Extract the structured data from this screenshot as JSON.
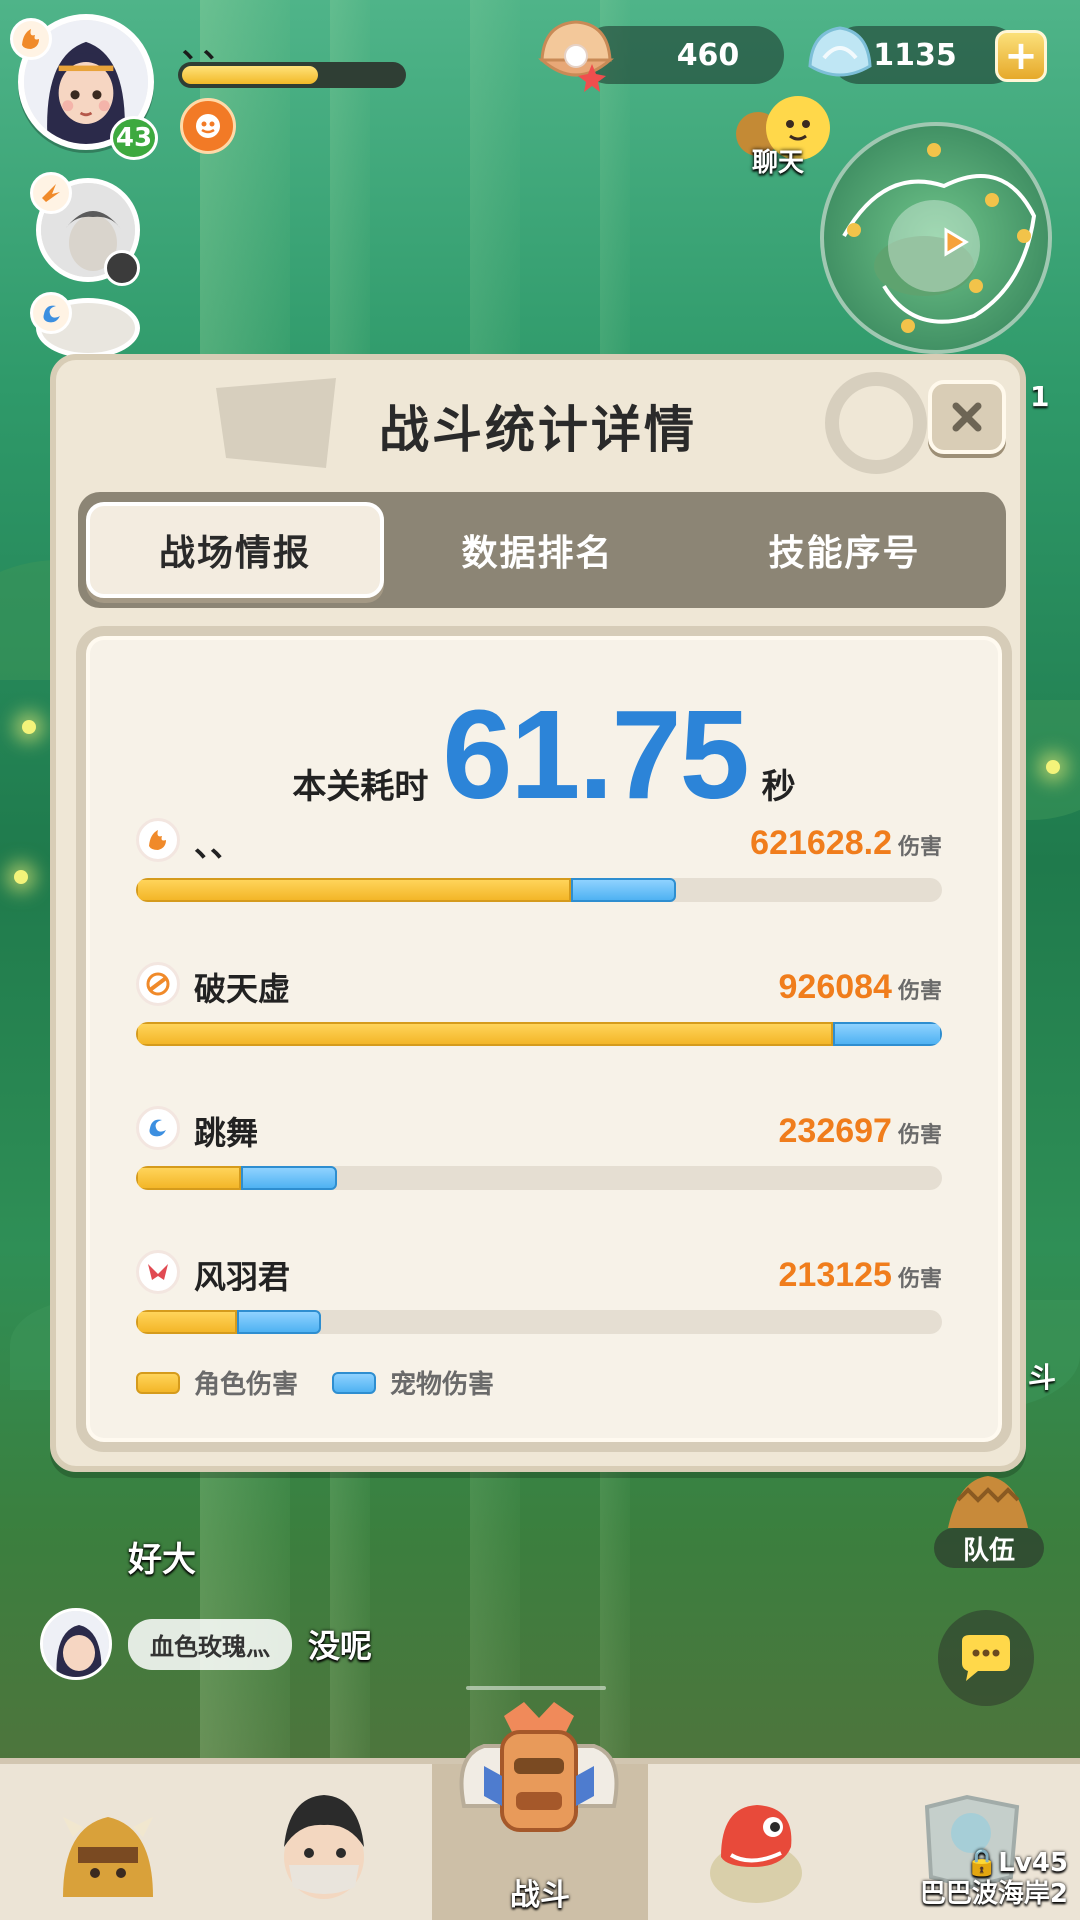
{
  "hud": {
    "player_name": "、、",
    "level": "43",
    "hp_fraction": 0.62,
    "currencies": [
      {
        "icon": "pearl-shell-icon",
        "value": "460"
      },
      {
        "icon": "crystal-shell-icon",
        "value": "1135"
      }
    ],
    "chat_shortcut_label": "聊天",
    "edge_fragments": {
      "right_1": "1",
      "right_2": "斗"
    }
  },
  "modal": {
    "title": "战斗统计详情",
    "tabs": [
      {
        "label": "战场情报",
        "active": true
      },
      {
        "label": "数据排名",
        "active": false
      },
      {
        "label": "技能序号",
        "active": false
      }
    ],
    "time": {
      "label": "本关耗时",
      "value": "61.75",
      "unit": "秒"
    },
    "damage_unit": "伤害",
    "players": [
      {
        "name": "、、",
        "class_icon": "flame-class-icon",
        "damage": "621628.2",
        "role_fraction": 0.54,
        "pet_fraction": 0.13
      },
      {
        "name": "破天虚",
        "class_icon": "wind-class-icon",
        "damage": "926084",
        "role_fraction": 0.865,
        "pet_fraction": 0.135
      },
      {
        "name": "跳舞",
        "class_icon": "water-class-icon",
        "damage": "232697",
        "role_fraction": 0.13,
        "pet_fraction": 0.12
      },
      {
        "name": "风羽君",
        "class_icon": "blade-class-icon",
        "damage": "213125",
        "role_fraction": 0.125,
        "pet_fraction": 0.105
      }
    ],
    "legend": [
      {
        "label": "角色伤害",
        "color": "#F5BE2E"
      },
      {
        "label": "宠物伤害",
        "color": "#5DB8F4"
      }
    ]
  },
  "chat": {
    "partial_line": "好大",
    "messages": [
      {
        "tag": "血色玫瑰灬",
        "text": "没呢"
      }
    ],
    "team_label": "队伍"
  },
  "bottom_nav": {
    "items": [
      {
        "id": "pets",
        "icon": "beast-icon",
        "label": ""
      },
      {
        "id": "character",
        "icon": "hero-icon",
        "label": ""
      },
      {
        "id": "battle",
        "icon": "battle-totem-icon",
        "label": "战斗"
      },
      {
        "id": "dino",
        "icon": "dino-icon",
        "label": ""
      },
      {
        "id": "map",
        "icon": "map-icon",
        "label": "",
        "lock_level": "Lv45",
        "lock_place": "巴巴波海岸2"
      }
    ]
  },
  "colors": {
    "accent_time": "#2C84D8",
    "damage_number": "#F07D1C",
    "hp_bar": "#F2B928",
    "level_badge": "#3DA93F"
  }
}
